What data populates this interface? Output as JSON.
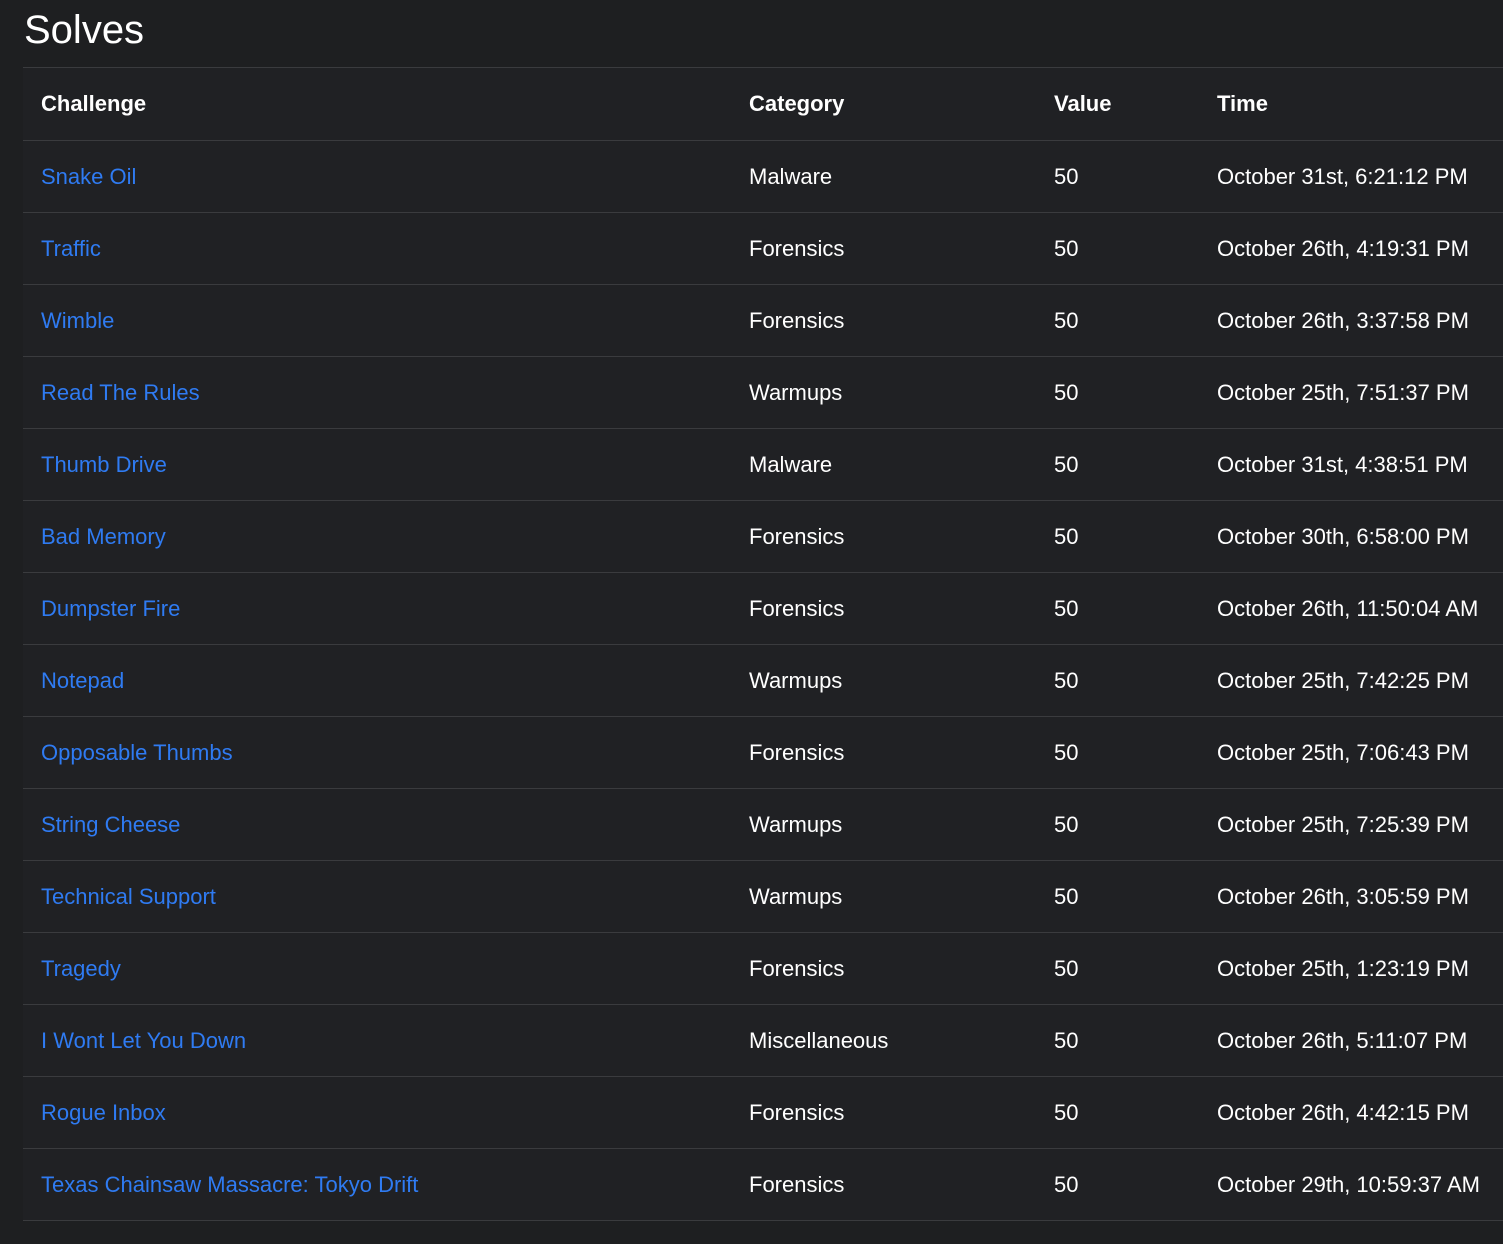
{
  "page": {
    "title": "Solves"
  },
  "colors": {
    "background": "#1e1f21",
    "link": "#2f7bf2",
    "text": "#ffffff",
    "border": "#3a3b3e"
  },
  "table": {
    "headers": {
      "challenge": "Challenge",
      "category": "Category",
      "value": "Value",
      "time": "Time"
    },
    "rows": [
      {
        "challenge": "Snake Oil",
        "category": "Malware",
        "value": "50",
        "time": "October 31st, 6:21:12 PM"
      },
      {
        "challenge": "Traffic",
        "category": "Forensics",
        "value": "50",
        "time": "October 26th, 4:19:31 PM"
      },
      {
        "challenge": "Wimble",
        "category": "Forensics",
        "value": "50",
        "time": "October 26th, 3:37:58 PM"
      },
      {
        "challenge": "Read The Rules",
        "category": "Warmups",
        "value": "50",
        "time": "October 25th, 7:51:37 PM"
      },
      {
        "challenge": "Thumb Drive",
        "category": "Malware",
        "value": "50",
        "time": "October 31st, 4:38:51 PM"
      },
      {
        "challenge": "Bad Memory",
        "category": "Forensics",
        "value": "50",
        "time": "October 30th, 6:58:00 PM"
      },
      {
        "challenge": "Dumpster Fire",
        "category": "Forensics",
        "value": "50",
        "time": "October 26th, 11:50:04 AM"
      },
      {
        "challenge": "Notepad",
        "category": "Warmups",
        "value": "50",
        "time": "October 25th, 7:42:25 PM"
      },
      {
        "challenge": "Opposable Thumbs",
        "category": "Forensics",
        "value": "50",
        "time": "October 25th, 7:06:43 PM"
      },
      {
        "challenge": "String Cheese",
        "category": "Warmups",
        "value": "50",
        "time": "October 25th, 7:25:39 PM"
      },
      {
        "challenge": "Technical Support",
        "category": "Warmups",
        "value": "50",
        "time": "October 26th, 3:05:59 PM"
      },
      {
        "challenge": "Tragedy",
        "category": "Forensics",
        "value": "50",
        "time": "October 25th, 1:23:19 PM"
      },
      {
        "challenge": "I Wont Let You Down",
        "category": "Miscellaneous",
        "value": "50",
        "time": "October 26th, 5:11:07 PM"
      },
      {
        "challenge": "Rogue Inbox",
        "category": "Forensics",
        "value": "50",
        "time": "October 26th, 4:42:15 PM"
      },
      {
        "challenge": "Texas Chainsaw Massacre: Tokyo Drift",
        "category": "Forensics",
        "value": "50",
        "time": "October 29th, 10:59:37 AM"
      }
    ]
  }
}
